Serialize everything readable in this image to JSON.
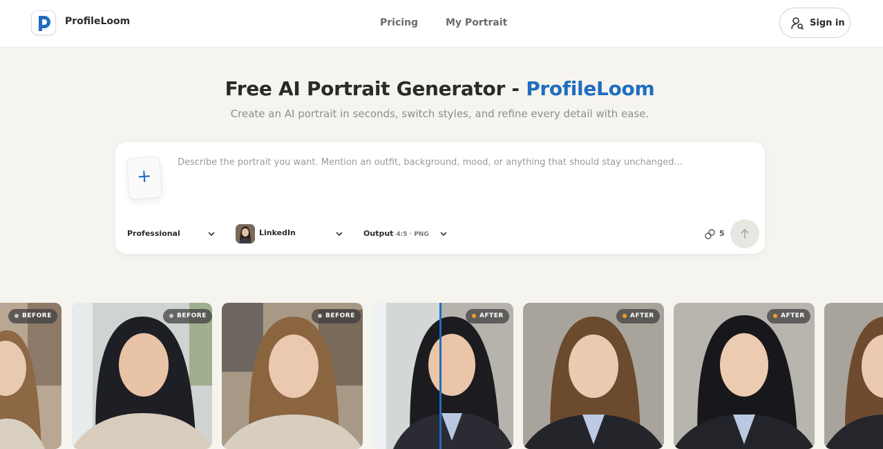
{
  "header": {
    "brand": "ProfileLoom",
    "nav": [
      "Pricing",
      "My Portrait"
    ],
    "sign_in": "Sign in"
  },
  "hero": {
    "title_prefix": "Free AI Portrait Generator - ",
    "title_brand": "ProfileLoom",
    "subtitle": "Create an AI portrait in seconds, switch styles, and refine every detail with ease."
  },
  "composer": {
    "prompt_placeholder": "Describe the portrait you want. Mention an outfit, background, mood, or anything that should stay unchanged...",
    "prompt_value": "",
    "upload_symbol": "+",
    "style_select": "Professional",
    "preset_select": "LinkedIn",
    "output_label": "Output",
    "output_format": "4:5 · PNG",
    "credits": "5"
  },
  "gallery": {
    "before_label": "BEFORE",
    "after_label": "AFTER"
  },
  "colors": {
    "accent": "#1f6dbf",
    "before_dot": "#c9c9c9",
    "after_dot": "#f0a020"
  }
}
